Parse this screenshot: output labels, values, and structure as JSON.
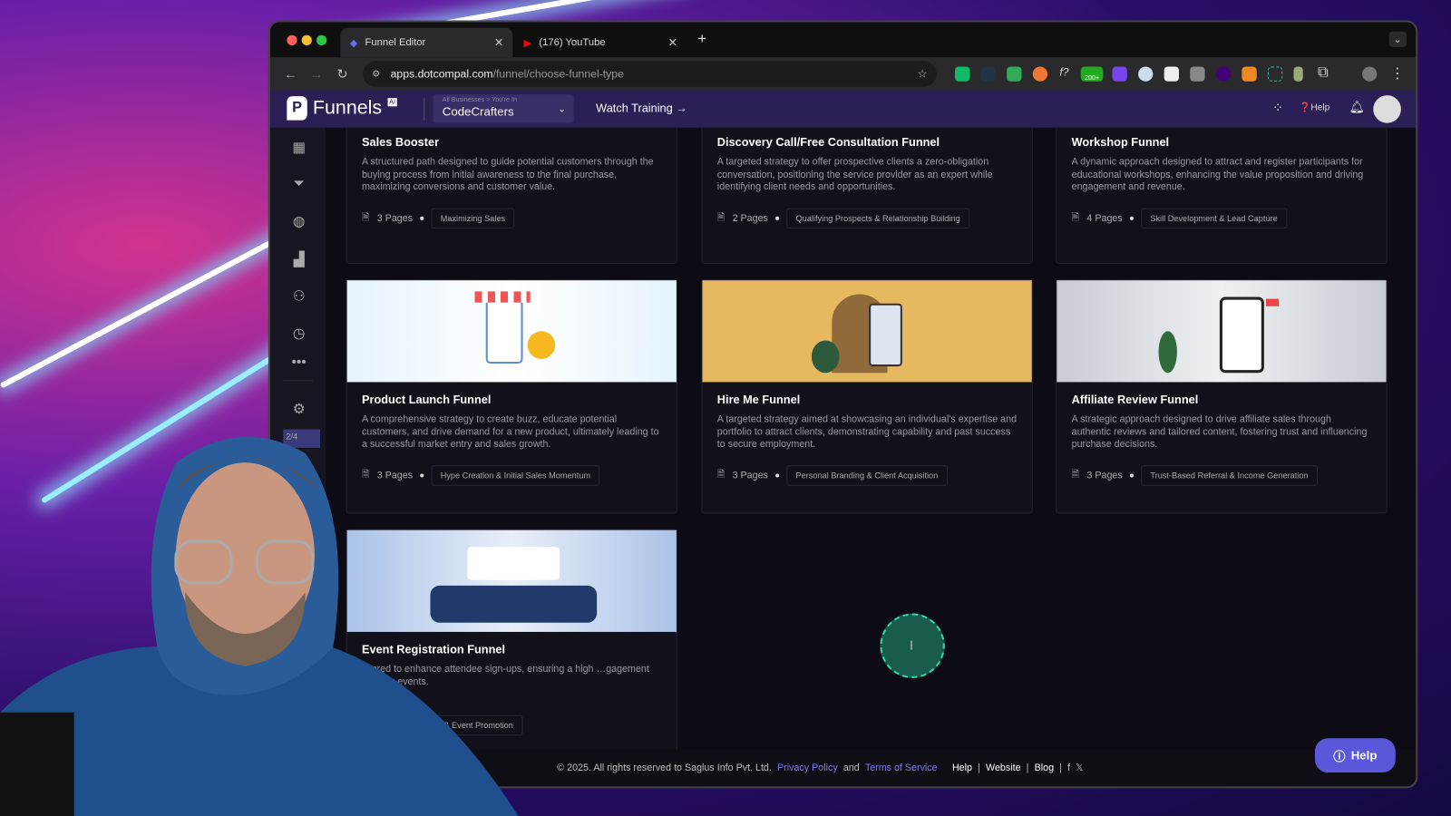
{
  "browser": {
    "tabs": [
      {
        "title": "Funnel Editor",
        "active": true
      },
      {
        "title": "(176) YouTube",
        "active": false
      }
    ],
    "url_host": "apps.dotcompal.com",
    "url_path": "/funnel/choose-funnel-type",
    "extension_badge": "200+"
  },
  "app": {
    "logo": "Funnels",
    "logo_badge": "AI",
    "business_label": "All Businesses > You're In",
    "business_name": "CodeCrafters",
    "watch_training": "Watch Training →",
    "help": "Help",
    "sidebar_page": "2/4",
    "accent": "#5b57d9",
    "header_bg": "#2b1f55"
  },
  "cards": [
    {
      "title": "Sales Booster",
      "desc": "A structured path designed to guide potential customers through the buying process from initial awareness to the final purchase, maximizing conversions and customer value.",
      "pages": "3 Pages",
      "tag": "Maximizing Sales"
    },
    {
      "title": "Discovery Call/Free Consultation Funnel",
      "desc": "A targeted strategy to offer prospective clients a zero-obligation conversation, positioning the service provider as an expert while identifying client needs and opportunities.",
      "pages": "2 Pages",
      "tag": "Qualifying Prospects & Relationship Building"
    },
    {
      "title": "Workshop Funnel",
      "desc": "A dynamic approach designed to attract and register participants for educational workshops, enhancing the value proposition and driving engagement and revenue.",
      "pages": "4 Pages",
      "tag": "Skill Development & Lead Capture"
    },
    {
      "title": "Product Launch Funnel",
      "desc": "A comprehensive strategy to create buzz, educate potential customers, and drive demand for a new product, ultimately leading to a successful market entry and sales growth.",
      "pages": "3 Pages",
      "tag": "Hype Creation & Initial Sales Momentum"
    },
    {
      "title": "Hire Me Funnel",
      "desc": "A targeted strategy aimed at showcasing an individual's expertise and portfolio to attract clients, demonstrating capability and past success to secure employment.",
      "pages": "3 Pages",
      "tag": "Personal Branding & Client Acquisition"
    },
    {
      "title": "Affiliate Review Funnel",
      "desc": "A strategic approach designed to drive affiliate sales through authentic reviews and tailored content, fostering trust and influencing purchase decisions.",
      "pages": "3 Pages",
      "tag": "Trust-Based Referral & Income Generation"
    },
    {
      "title": "Event Registration Funnel",
      "desc": "…ored to enhance attendee sign-ups, ensuring a high …gagement for your events.",
      "pages": "",
      "tag": "…tendee Sign-Ups & Event Promotion"
    }
  ],
  "footer": {
    "copyright": "©  2025. All rights reserved to Saglus Info Pvt. Ltd.",
    "privacy": "Privacy Policy",
    "and": "and",
    "terms": "Terms of Service",
    "help": "Help",
    "website": "Website",
    "blog": "Blog"
  },
  "help_button": "Help"
}
